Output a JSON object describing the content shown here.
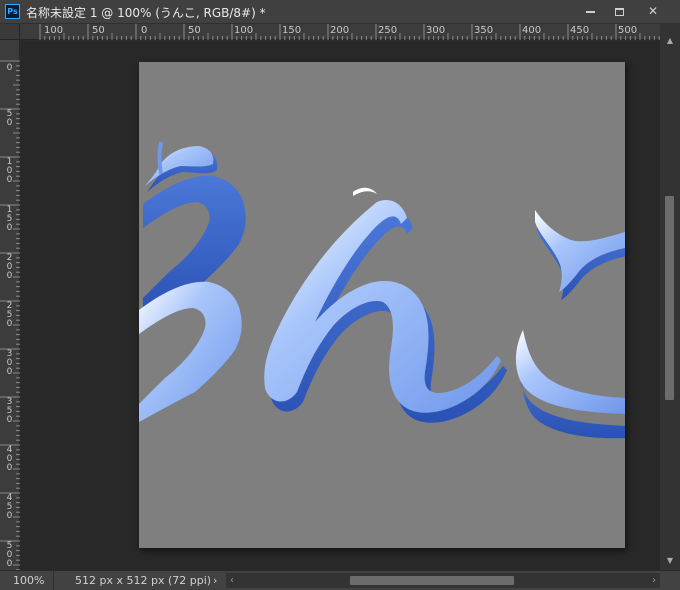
{
  "window": {
    "app_icon_text": "Ps",
    "title": "名称未設定 1 @ 100% (うんこ, RGB/8#) *"
  },
  "ruler_top_labels": [
    "100",
    "50",
    "0",
    "50",
    "100",
    "150",
    "200",
    "250",
    "300",
    "350",
    "400",
    "450",
    "500"
  ],
  "ruler_left_labels": [
    "0",
    "50",
    "100",
    "150",
    "200",
    "250",
    "300",
    "350",
    "400",
    "450",
    "500"
  ],
  "document": {
    "background_color": "#7f7f7f",
    "text_color": "#7ea6f0",
    "shadow_color": "#2f5cc0",
    "highlight_color": "#ffffff"
  },
  "status": {
    "zoom": "100%",
    "doc_info": "512 px x 512 px (72 ppi)",
    "arrow": "›"
  },
  "icons": {
    "minimize": "minimize-icon",
    "maximize": "maximize-icon",
    "close": "close-icon"
  }
}
